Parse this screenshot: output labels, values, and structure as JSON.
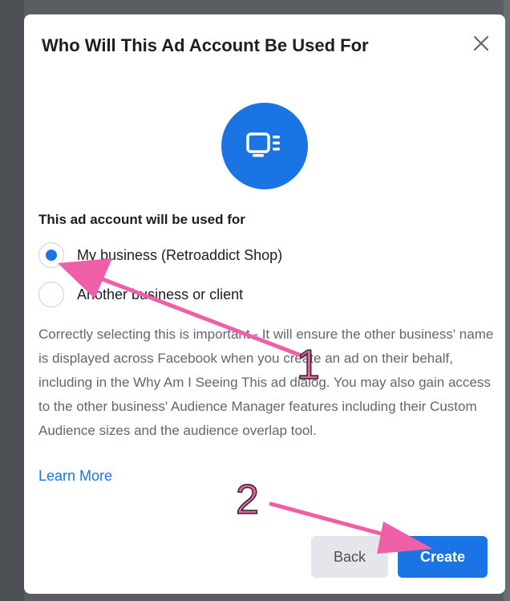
{
  "dialog": {
    "title": "Who Will This Ad Account Be Used For",
    "close_icon": "close-icon",
    "hero_icon": "ad-account-icon",
    "section_label": "This ad account will be used for",
    "options": [
      {
        "label": "My business (Retroaddict Shop)",
        "selected": true
      },
      {
        "label": "Another business or client",
        "selected": false
      }
    ],
    "description": "Correctly selecting this is important - It will ensure the other business' name is displayed across Facebook when you create an ad on their behalf, including in the Why Am I Seeing This ad dialog. You may also gain access to the other business' Audience Manager features including their Custom Audience sizes and the audience overlap tool.",
    "learn_more": "Learn More",
    "buttons": {
      "back": "Back",
      "create": "Create"
    }
  },
  "annotations": {
    "step1": "1",
    "step2": "2",
    "arrow_color": "#ef5fa7"
  },
  "colors": {
    "accent": "#1b74e4",
    "text": "#1c1e21",
    "muted": "#606770"
  }
}
